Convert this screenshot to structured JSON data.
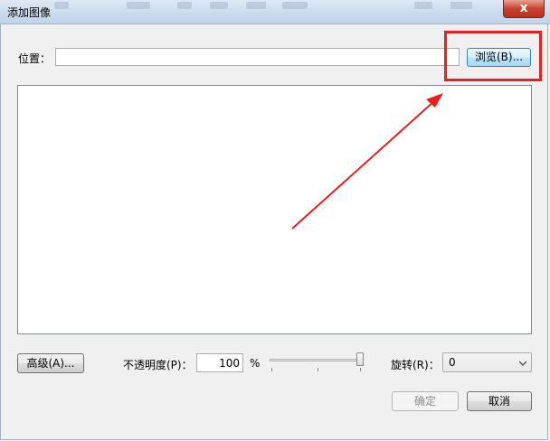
{
  "window": {
    "title": "添加图像",
    "close_glyph": "x"
  },
  "location": {
    "label": "位置：",
    "value": "",
    "browse_label": "浏览(B)..."
  },
  "controls": {
    "advanced_label": "高级(A)...",
    "opacity_label": "不透明度(P)：",
    "opacity_value": "100",
    "percent_sign": "%",
    "opacity_slider_fraction": 1.0,
    "rotate_label": "旋转(R)：",
    "rotate_value": "0"
  },
  "footer": {
    "ok_label": "确定",
    "cancel_label": "取消"
  },
  "annotations": {
    "highlight_color": "#e8201f",
    "arrow_color": "#e8201f"
  }
}
